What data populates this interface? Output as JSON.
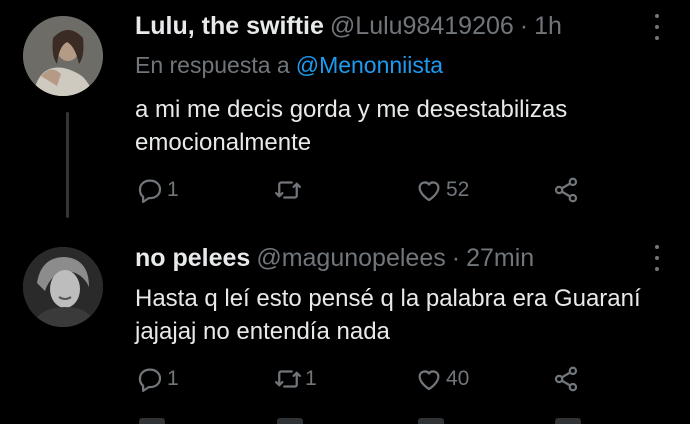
{
  "tweets": [
    {
      "name": "Lulu, the swiftie",
      "handle": "@Lulu98419206",
      "separator": "·",
      "time": "1h",
      "reply_prefix": "En respuesta a",
      "reply_mention": "@Menonniista",
      "text": "a mi me decis gorda y me desestabilizas emocionalmente",
      "replies": "1",
      "retweets": "",
      "likes": "52",
      "avatar_icon": "profile-photo-woman-icon"
    },
    {
      "name": "no pelees",
      "handle": "@magunopelees",
      "separator": "·",
      "time": "27min",
      "text": "Hasta q leí esto pensé q la palabra era Guaraní jajajaj no entendía nada",
      "replies": "1",
      "retweets": "1",
      "likes": "40",
      "avatar_icon": "profile-photo-woman-icon"
    }
  ],
  "colors": {
    "background": "#000000",
    "text": "#e7e9ea",
    "muted": "#71767b",
    "link": "#1d9bf0"
  },
  "icons": [
    "reply-icon",
    "retweet-icon",
    "like-icon",
    "share-icon",
    "more-options-icon"
  ]
}
